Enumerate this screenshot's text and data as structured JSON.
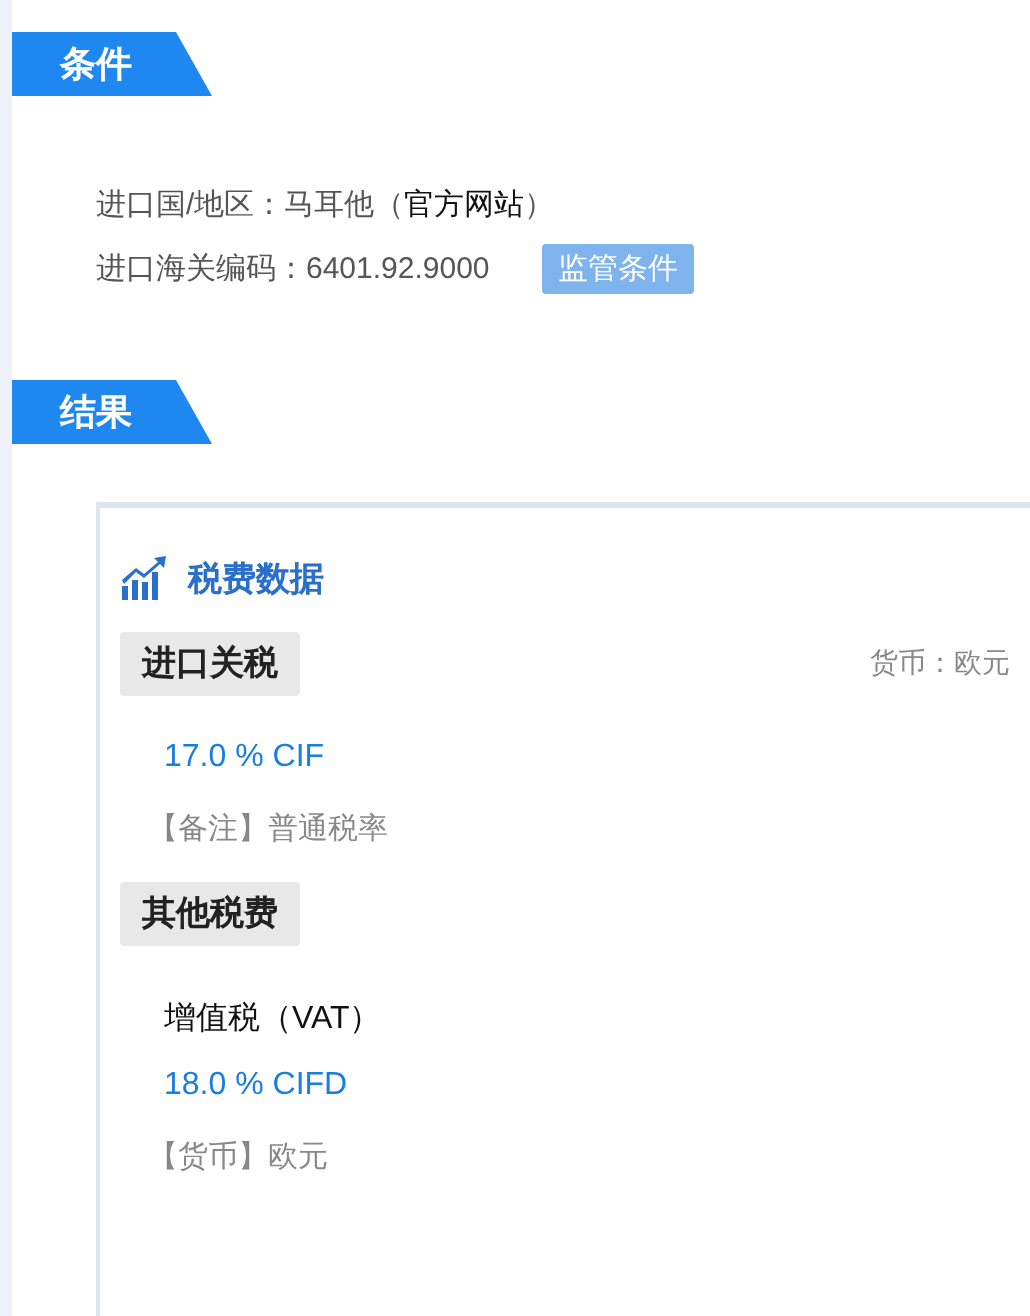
{
  "conditions": {
    "heading": "条件",
    "country_label": "进口国/地区：马耳他（",
    "country_link": "官方网站",
    "country_close": "）",
    "code_label": "进口海关编码：6401.92.9000",
    "regulation_button": "监管条件"
  },
  "results": {
    "heading": "结果",
    "card": {
      "title": "税费数据",
      "import_duty": {
        "tag": "进口关税",
        "currency": "货币：欧元",
        "rate": "17.0 % CIF",
        "note": "【备注】普通税率"
      },
      "other_fees": {
        "tag": "其他税费",
        "items": [
          {
            "name": "增值税（VAT）",
            "rate": "18.0 % CIFD",
            "note": "【货币】欧元"
          }
        ]
      }
    }
  }
}
